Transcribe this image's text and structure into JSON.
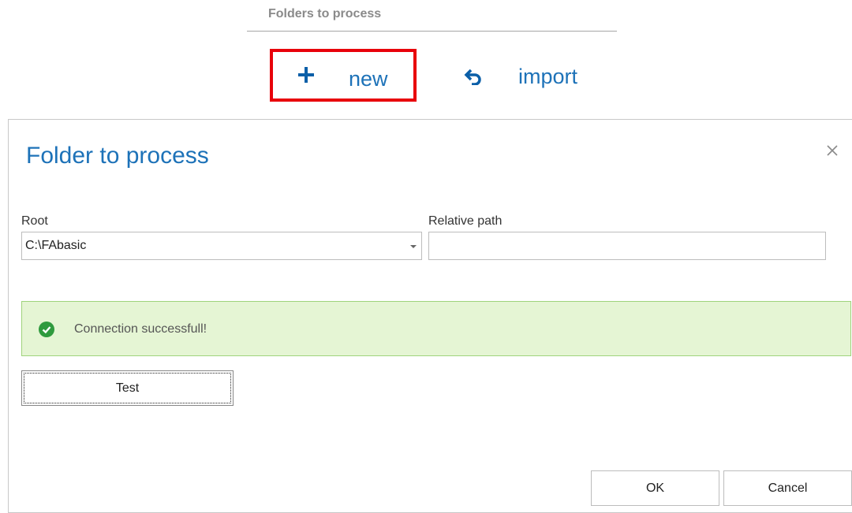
{
  "header": {
    "title": "Folders to process",
    "new_label": "new",
    "import_label": "import"
  },
  "dialog": {
    "title": "Folder to process",
    "root_label": "Root",
    "root_value": "C:\\FAbasic",
    "relative_path_label": "Relative path",
    "relative_path_value": "",
    "alert_text": "Connection successfull!",
    "test_label": "Test",
    "ok_label": "OK",
    "cancel_label": "Cancel"
  },
  "colors": {
    "accent": "#1d72b8",
    "highlight_border": "#e8000b",
    "success_bg": "#e5f5d4",
    "success_icon": "#2f9a3e"
  },
  "icons": [
    "plus-icon",
    "undo-icon",
    "close-icon",
    "chevron-down-icon",
    "check-circle-icon"
  ]
}
